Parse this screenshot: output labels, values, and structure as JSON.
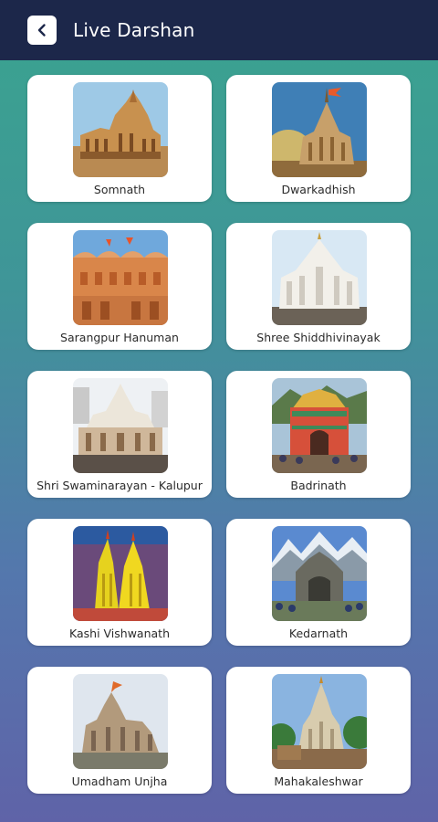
{
  "header": {
    "title": "Live Darshan"
  },
  "temples": [
    {
      "name": "Somnath"
    },
    {
      "name": "Dwarkadhish"
    },
    {
      "name": "Sarangpur Hanuman"
    },
    {
      "name": "Shree Shiddhivinayak"
    },
    {
      "name": "Shri Swaminarayan - Kalupur"
    },
    {
      "name": "Badrinath"
    },
    {
      "name": "Kashi Vishwanath"
    },
    {
      "name": "Kedarnath"
    },
    {
      "name": "Umadham Unjha"
    },
    {
      "name": "Mahakaleshwar"
    }
  ],
  "colors": {
    "header_bg": "#1c274a",
    "bg_gradient_top": "#3aa48f",
    "bg_gradient_bottom": "#5f63a8",
    "card_bg": "#ffffff"
  }
}
